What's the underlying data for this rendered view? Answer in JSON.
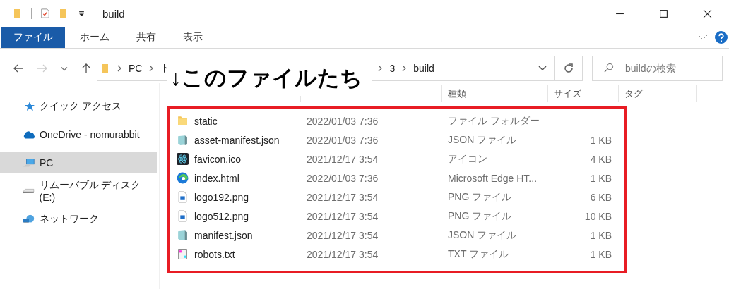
{
  "window": {
    "title": "build"
  },
  "ribbon_tabs": [
    {
      "label": "ファイル",
      "selected": true
    },
    {
      "label": "ホーム",
      "selected": false
    },
    {
      "label": "共有",
      "selected": false
    },
    {
      "label": "表示",
      "selected": false
    }
  ],
  "address_bar": {
    "breadcrumbs": [
      "PC",
      "ド",
      "3",
      "build"
    ]
  },
  "search": {
    "placeholder": "buildの検索"
  },
  "sidebar": {
    "items": [
      {
        "label": "クイック アクセス",
        "kind": "star",
        "selected": false
      },
      {
        "label": "OneDrive - nomurabbit",
        "kind": "cloud",
        "selected": false
      },
      {
        "label": "PC",
        "kind": "pc",
        "selected": true
      },
      {
        "label": "リムーバブル ディスク (E:)",
        "kind": "drive",
        "selected": false
      },
      {
        "label": "ネットワーク",
        "kind": "network",
        "selected": false
      }
    ]
  },
  "table": {
    "columns": [
      "種類",
      "サイズ",
      "タグ"
    ],
    "rows": [
      {
        "name": "static",
        "date": "2022/01/03 7:36",
        "type": "ファイル フォルダー",
        "kind": "folder"
      },
      {
        "name": "asset-manifest.json",
        "date": "2022/01/03 7:36",
        "type": "JSON ファイル",
        "size": "1 KB",
        "kind": "json"
      },
      {
        "name": "favicon.ico",
        "date": "2021/12/17 3:54",
        "type": "アイコン",
        "size": "4 KB",
        "kind": "react"
      },
      {
        "name": "index.html",
        "date": "2022/01/03 7:36",
        "type": "Microsoft Edge HT...",
        "size": "1 KB",
        "kind": "edge"
      },
      {
        "name": "logo192.png",
        "date": "2021/12/17 3:54",
        "type": "PNG ファイル",
        "size": "6 KB",
        "kind": "image"
      },
      {
        "name": "logo512.png",
        "date": "2021/12/17 3:54",
        "type": "PNG ファイル",
        "size": "10 KB",
        "kind": "image"
      },
      {
        "name": "manifest.json",
        "date": "2021/12/17 3:54",
        "type": "JSON ファイル",
        "size": "1 KB",
        "kind": "json"
      },
      {
        "name": "robots.txt",
        "date": "2021/12/17 3:54",
        "type": "TXT ファイル",
        "size": "1 KB",
        "kind": "text"
      }
    ]
  },
  "annotation": {
    "text": "↓このファイルたち"
  }
}
